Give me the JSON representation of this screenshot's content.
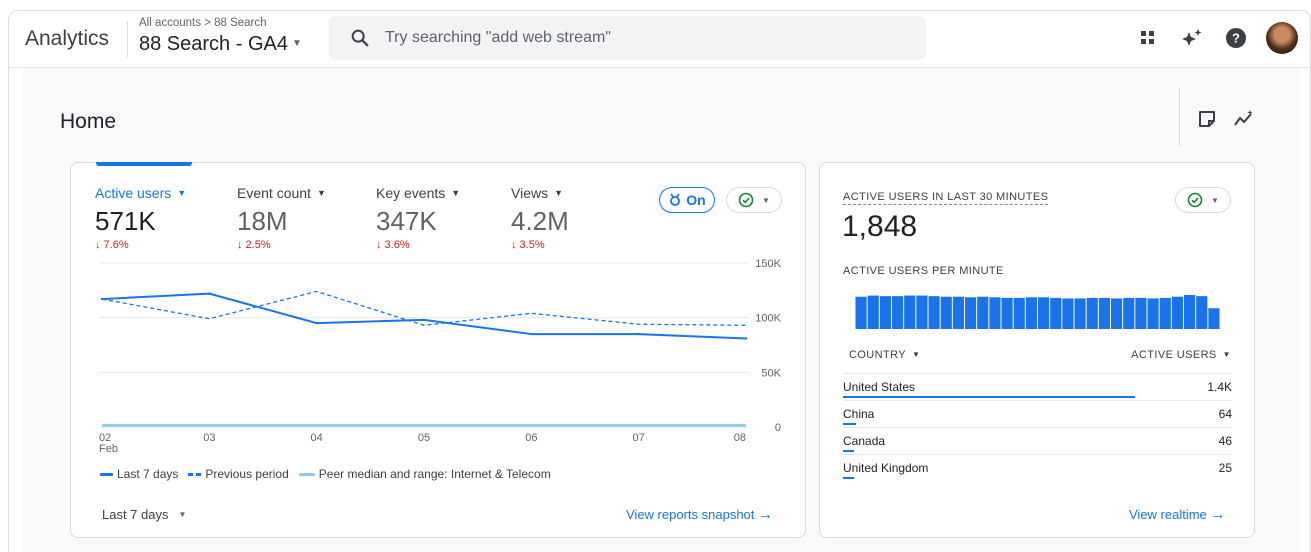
{
  "header": {
    "app_title": "Analytics",
    "breadcrumb": "All accounts > 88 Search",
    "property_name": "88 Search - GA4",
    "search_placeholder": "Try searching \"add web stream\""
  },
  "page": {
    "title": "Home"
  },
  "overview_card": {
    "metrics": [
      {
        "label": "Active users",
        "value": "571K",
        "change": "↓ 7.6%"
      },
      {
        "label": "Event count",
        "value": "18M",
        "change": "↓ 2.5%"
      },
      {
        "label": "Key events",
        "value": "347K",
        "change": "↓ 3.6%"
      },
      {
        "label": "Views",
        "value": "4.2M",
        "change": "↓ 3.5%"
      }
    ],
    "benchmark_toggle_label": "On",
    "date_range_label": "Last 7 days",
    "view_link": "View reports snapshot"
  },
  "realtime_card": {
    "title": "ACTIVE USERS IN LAST 30 MINUTES",
    "value": "1,848",
    "per_minute_label": "ACTIVE USERS PER MINUTE",
    "per_minute_values": [
      56,
      58,
      57,
      57,
      58,
      58,
      57,
      56,
      56,
      55,
      56,
      55,
      54,
      54,
      55,
      55,
      54,
      53,
      53,
      54,
      54,
      53,
      54,
      54,
      53,
      54,
      56,
      59,
      57,
      36
    ],
    "col_country": "COUNTRY",
    "col_users": "ACTIVE USERS",
    "rows": [
      {
        "country": "United States",
        "value": "1.4K",
        "share": 0.75
      },
      {
        "country": "China",
        "value": "64",
        "share": 0.034
      },
      {
        "country": "Canada",
        "value": "46",
        "share": 0.024
      },
      {
        "country": "United Kingdom",
        "value": "25",
        "share": 0.013
      }
    ],
    "view_link": "View realtime"
  },
  "colors": {
    "accent": "#1a73e8",
    "negative": "#c5221f",
    "peer": "#8ed0e0"
  },
  "chart_data": {
    "type": "line",
    "x": [
      "02",
      "03",
      "04",
      "05",
      "06",
      "07",
      "08"
    ],
    "x_sublabel": "Feb",
    "y_ticks": [
      "150K",
      "100K",
      "50K",
      "0"
    ],
    "ylim": [
      0,
      150000
    ],
    "grid": true,
    "legend_position": "bottom-left",
    "series": [
      {
        "name": "Last 7 days",
        "style": "solid",
        "values": [
          117000,
          122000,
          95000,
          98000,
          85000,
          85000,
          81000
        ]
      },
      {
        "name": "Previous period",
        "style": "dashed",
        "values": [
          117000,
          99000,
          124000,
          93000,
          104000,
          94000,
          93000
        ]
      },
      {
        "name": "Peer median and range: Internet & Telecom",
        "style": "band",
        "values": [
          1500,
          1500,
          1500,
          1500,
          1500,
          1500,
          1500
        ]
      }
    ]
  }
}
